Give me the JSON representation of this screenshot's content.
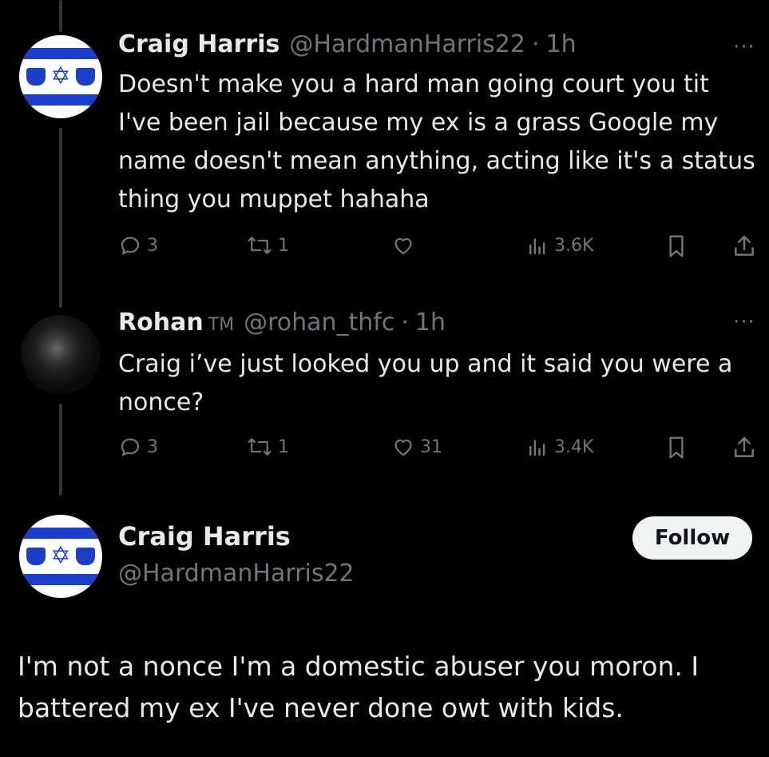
{
  "tweets": [
    {
      "name": "Craig Harris",
      "handle": "@HardmanHarris22",
      "time": "1h",
      "text": "Doesn't make you a hard man going court you tit I've been jail because my ex is a grass Google my name doesn't mean anything, acting like it's a status thing you muppet hahaha",
      "replies": "3",
      "reposts": "1",
      "likes": "",
      "views": "3.6K",
      "avatar_icon": "everton-israel-flag-avatar"
    },
    {
      "name": "Rohan",
      "name_suffix": "TM",
      "handle": "@rohan_thfc",
      "time": "1h",
      "text": "Craig i’ve just looked you up and it said you were a nonce?",
      "replies": "3",
      "reposts": "1",
      "likes": "31",
      "views": "3.4K",
      "avatar_icon": "dark-photo-avatar"
    }
  ],
  "main_tweet": {
    "name": "Craig Harris",
    "handle": "@HardmanHarris22",
    "follow_label": "Follow",
    "text": "I'm not a nonce I'm a domestic abuser you moron. I battered my ex I've never done owt with kids."
  },
  "separator": "·",
  "more_label": "···",
  "colors": {
    "background": "#000000",
    "text": "#e7e9ea",
    "muted": "#71767b",
    "thread_line": "#333639",
    "flag_blue": "#1b3fc8",
    "follow_bg": "#eff3f4"
  }
}
